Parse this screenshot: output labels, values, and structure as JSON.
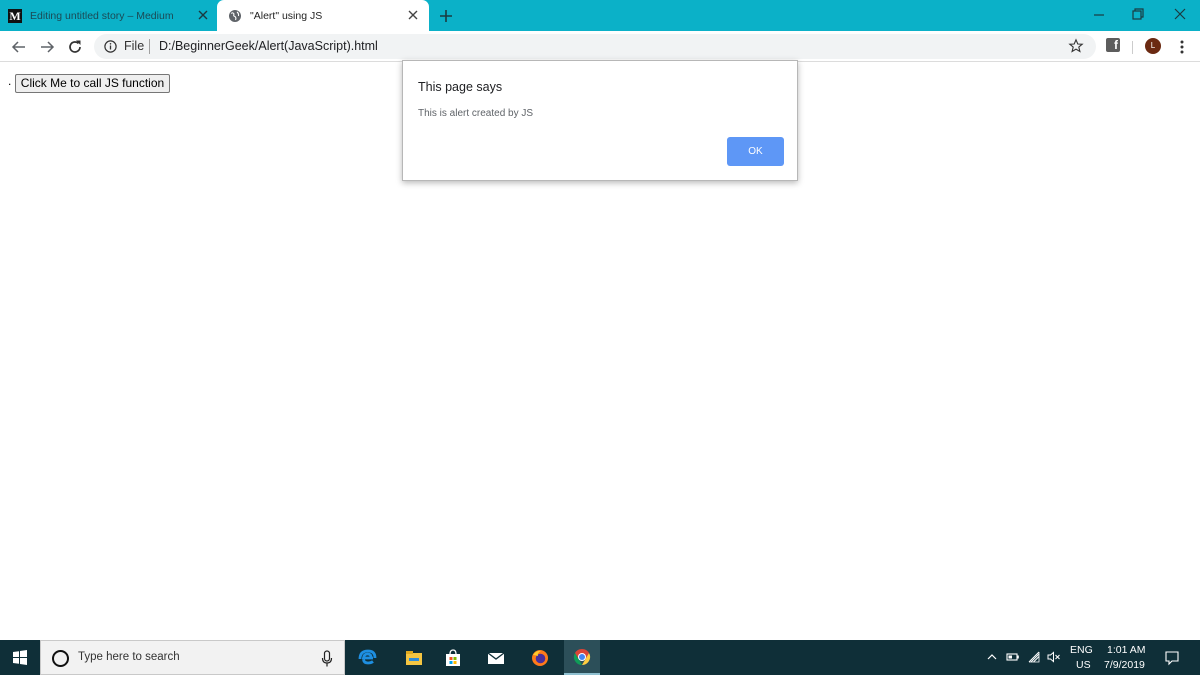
{
  "browser": {
    "tabs": [
      {
        "favicon": "medium-logo-icon",
        "favicon_text": "M",
        "title": "Editing untitled story – Medium",
        "active": false
      },
      {
        "favicon": "globe-icon",
        "title": "\"Alert\" using JS",
        "active": true
      }
    ],
    "new_tab_icon": "plus-icon",
    "window_controls": [
      "minimize-icon",
      "restore-icon",
      "close-icon"
    ],
    "nav_icons": [
      "back-arrow-icon",
      "forward-arrow-icon",
      "reload-icon"
    ],
    "address_bar": {
      "scheme_label": "File",
      "url": "D:/BeginnerGeek/Alert(JavaScript).html"
    },
    "toolbar_icons": [
      "bookmark-star-icon",
      "facebook-extension-icon",
      "chrome-menu-icon"
    ],
    "extension_letter": "f",
    "profile_initial": "L"
  },
  "page": {
    "bullet": ".",
    "button_label": "Click Me to call JS function"
  },
  "alert": {
    "title": "This page says",
    "message": "This is alert created by JS",
    "ok_label": "OK"
  },
  "taskbar": {
    "search_placeholder": "Type here to search",
    "apps": [
      "edge-icon",
      "file-explorer-icon",
      "store-icon",
      "mail-icon",
      "firefox-icon",
      "chrome-icon"
    ],
    "active_app": "chrome-icon",
    "tray_icons": [
      "show-hidden-icons-chevron",
      "battery-icon",
      "wifi-icon",
      "volume-muted-icon"
    ],
    "language": "ENG",
    "region": "US",
    "time": "1:01 AM",
    "date": "7/9/2019"
  },
  "colors": {
    "tab_strip": "#0bb1c8",
    "taskbar": "#0f2f38",
    "ok_button": "#5e97f6",
    "avatar": "#6b2a12"
  }
}
